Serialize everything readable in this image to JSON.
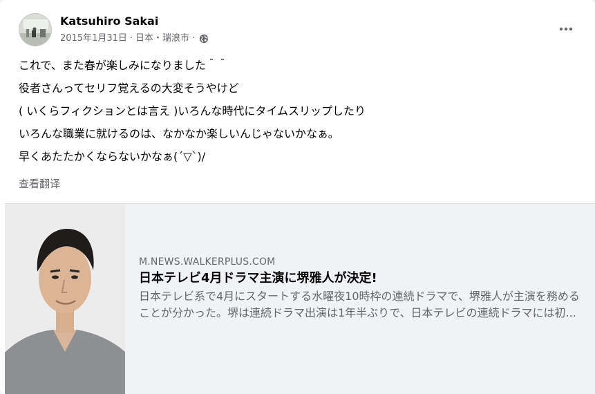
{
  "post": {
    "author": "Katsuhiro Sakai",
    "date": "2015年1月31日",
    "location": "日本・瑞浪市",
    "separator": "·",
    "privacy_icon": "globe-icon",
    "more_icon": "more-horizontal-icon",
    "text_lines": [
      "これで、また春が楽しみになりました＾＾",
      "役者さんってセリフ覚えるの大変そうやけど",
      "( いくらフィクションとは言え )いろんな時代にタイムスリップしたり",
      "いろんな職業に就けるのは、なかなか楽しいんじゃないかなぁ。",
      "早くあたたかくならないかなぁ(´▽`)/"
    ],
    "see_translation": "查看翻译"
  },
  "link_preview": {
    "domain": "M.NEWS.WALKERPLUS.COM",
    "title": "日本テレビ4月ドラマ主演に堺雅人が決定!",
    "description": "日本テレビ系で4月にスタートする水曜夜10時枠の連続ドラマで、堺雅人が主演を務めることが分かった。堺は連続ドラマ出演は1年半ぶりで、日本テレビの連続ドラマには初..."
  },
  "colors": {
    "secondary_text": "#65676b",
    "primary_text": "#050505",
    "preview_bg": "#f0f2f5"
  }
}
